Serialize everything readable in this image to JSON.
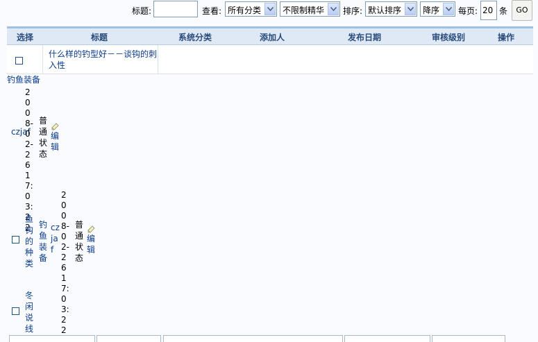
{
  "filters": {
    "title_label": "标题:",
    "title_value": "",
    "view_label": "查看:",
    "category_select": "所有分类",
    "elite_select": "不限制精华",
    "sort_label": "排序:",
    "sort_select": "默认排序",
    "order_select": "降序",
    "per_page_label": "每页:",
    "per_page_value": "20",
    "per_page_unit": "条",
    "go_button": "GO"
  },
  "table": {
    "headers": [
      "选择",
      "标题",
      "系统分类",
      "添加人",
      "发布日期",
      "审核级别",
      "操作"
    ]
  },
  "rows": [
    {
      "title": "什么样的钓型好－－谈钩的刺入性",
      "category": "钓鱼装备",
      "author": "czjaf",
      "date": "2008-02-26 17:03:22",
      "status": "普通状态",
      "action": "编辑"
    },
    {
      "title": "鱼钩的种类",
      "category": "钓鱼装备",
      "author": "czjaf",
      "date": "2008-02-26 17:03:22",
      "status": "普通状态",
      "action": "编辑"
    },
    {
      "title": "冬闲说线"
    }
  ],
  "colors": {
    "link": "#0b3c8c",
    "header_bg": "#dfe9f5",
    "header_border": "#9ec0e4",
    "page_bg": "#fafbfe"
  },
  "icons": {
    "edit": "pencil-edit-icon",
    "dropdown": "chevron-down-icon"
  }
}
